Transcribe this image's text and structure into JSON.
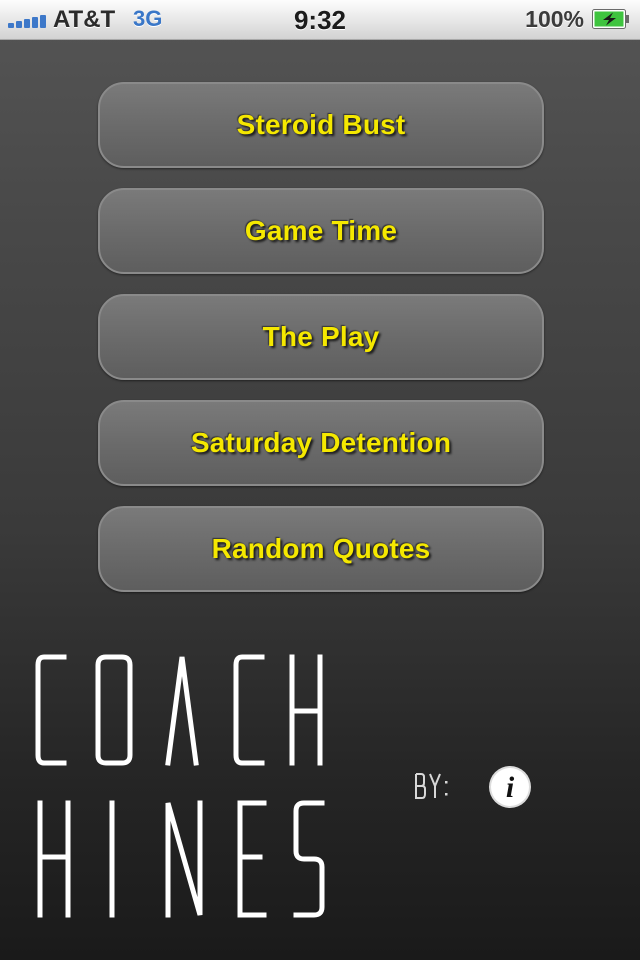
{
  "status_bar": {
    "carrier": "AT&T",
    "network": "3G",
    "time": "9:32",
    "battery_percent": "100%",
    "battery_level": 1.0,
    "battery_state": "charging",
    "signal_bars": 5
  },
  "menu": {
    "items": [
      {
        "label": "Steroid Bust"
      },
      {
        "label": "Game Time"
      },
      {
        "label": "The Play"
      },
      {
        "label": "Saturday Detention"
      },
      {
        "label": "Random Quotes"
      }
    ]
  },
  "logo": {
    "line1": "COACH",
    "line2": "HINES"
  },
  "credits": {
    "by_label": "BY:",
    "info_icon": "info-icon",
    "info_glyph": "i"
  },
  "colors": {
    "button_text": "#f5e800",
    "network_blue": "#3a77c8",
    "battery_green": "#3fc43f"
  }
}
